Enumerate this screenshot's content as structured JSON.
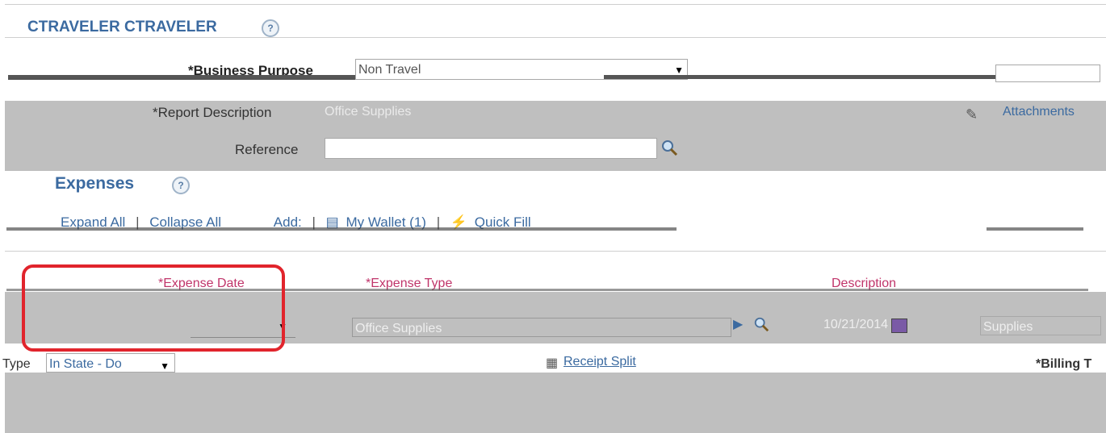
{
  "header": {
    "title": "CTRAVELER CTRAVELER",
    "help": "?"
  },
  "business_purpose": {
    "label": "*Business Purpose",
    "value": "Non Travel"
  },
  "report_description": {
    "label": "*Report Description",
    "value": "Office Supplies"
  },
  "attachments": {
    "label": "Attachments"
  },
  "reference": {
    "label": "Reference",
    "value": ""
  },
  "expenses": {
    "title": "Expenses",
    "help": "?",
    "expand_all": "Expand All",
    "collapse_all": "Collapse All",
    "add": "Add:",
    "my_wallet": "My Wallet (1)",
    "quick_fill": "Quick Fill",
    "separator": "|"
  },
  "columns": {
    "date": "*Expense Date",
    "type": "*Expense Type",
    "description": "Description"
  },
  "row": {
    "expense_type": "Office Supplies",
    "date": "10/21/2014",
    "description": "Supplies"
  },
  "detail": {
    "type_label": "Type",
    "type_value": "In State - Do",
    "receipt_split": "Receipt Split",
    "billing_label": "*Billing T"
  },
  "colors": {
    "highlight": "#e1242c",
    "link": "#3b6aa0",
    "column_header": "#c0356a"
  }
}
